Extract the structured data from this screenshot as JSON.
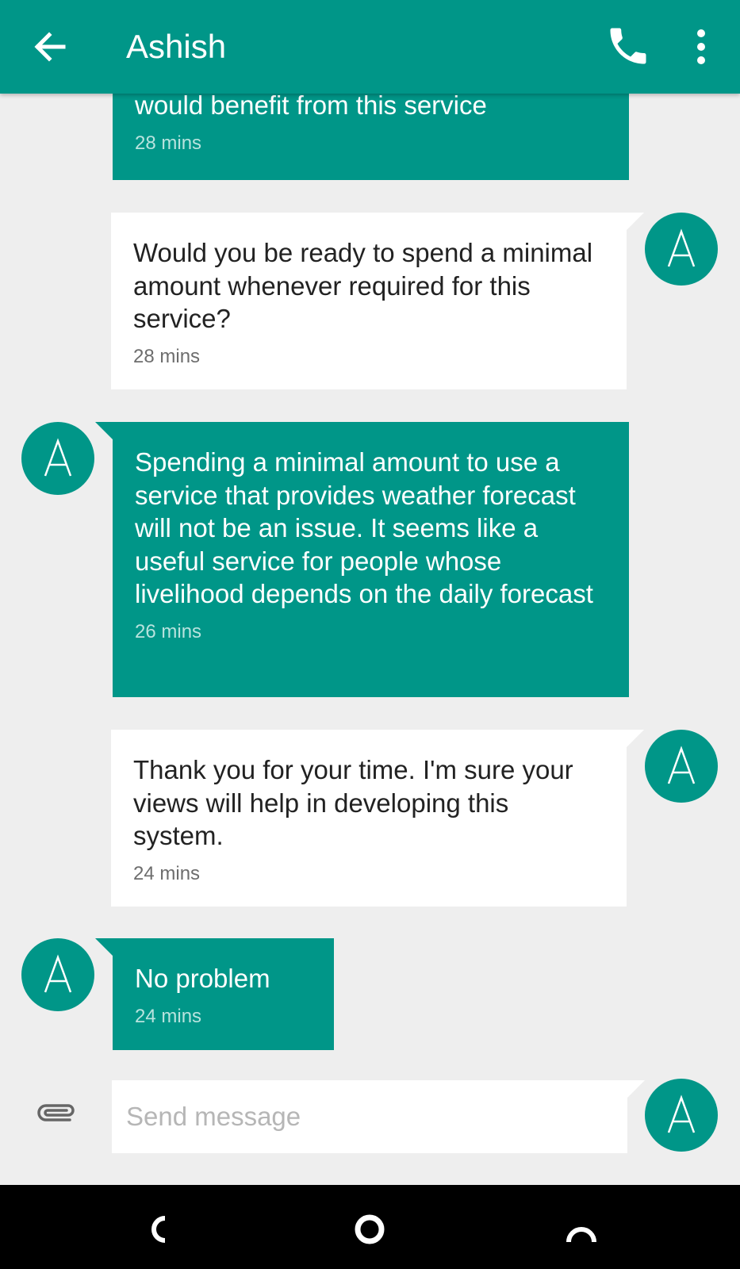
{
  "header": {
    "contact_name": "Ashish",
    "back_icon": "arrow-left-icon",
    "call_icon": "phone-icon",
    "menu_icon": "more-vert-icon"
  },
  "colors": {
    "primary": "#009688",
    "background": "#eeeeee",
    "incoming_bubble": "#ffffff"
  },
  "messages": [
    {
      "direction": "sent",
      "text": "would benefit from this service",
      "time": "28 mins"
    },
    {
      "direction": "received",
      "text": "Would you be ready to spend a minimal amount whenever required for this service?",
      "time": "28 mins",
      "avatar_letter": "A"
    },
    {
      "direction": "sent",
      "text": "Spending a minimal amount to use a service that provides weather forecast will not be an issue. It seems like a useful service for people whose livelihood depends on the daily forecast",
      "time": "26 mins",
      "avatar_letter": "A"
    },
    {
      "direction": "received",
      "text": "Thank you for your time. I'm sure your views will help in developing this system.",
      "time": "24 mins",
      "avatar_letter": "A"
    },
    {
      "direction": "sent",
      "text": "No problem",
      "time": "24 mins",
      "avatar_letter": "A"
    }
  ],
  "compose": {
    "placeholder": "Send message",
    "avatar_letter": "A",
    "attach_icon": "paperclip-icon"
  },
  "navbar": {
    "back_icon": "back-arc-icon",
    "home_icon": "home-circle-icon",
    "recents_icon": "recents-arc-icon"
  }
}
